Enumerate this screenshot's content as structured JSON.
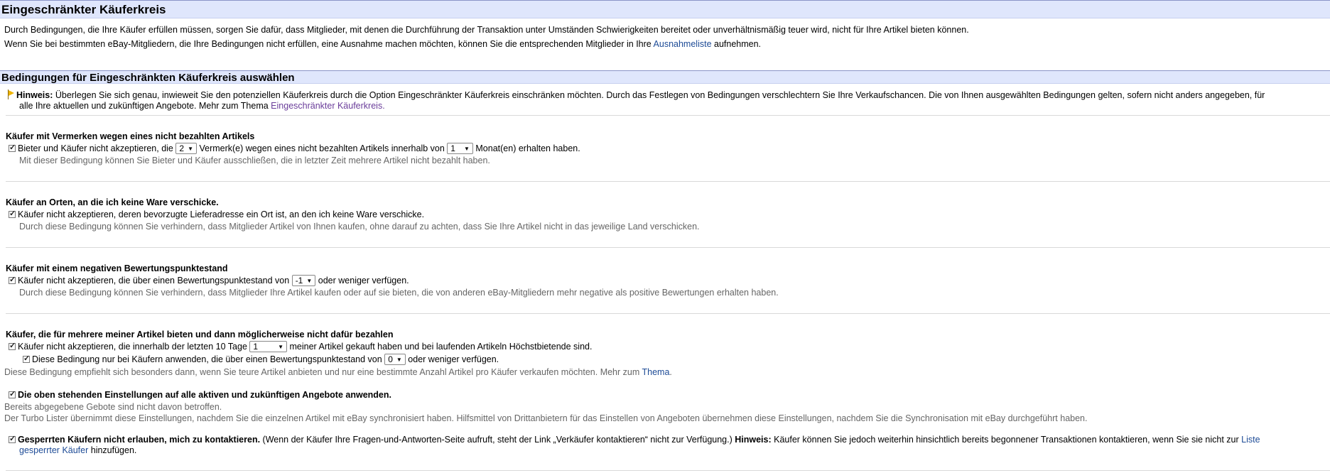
{
  "header": {
    "title": "Eingeschränkter Käuferkreis"
  },
  "intro": {
    "p1": "Durch Bedingungen, die Ihre Käufer erfüllen müssen, sorgen Sie dafür, dass Mitglieder, mit denen die Durchführung der Transaktion unter Umständen Schwierigkeiten bereitet oder unverhältnismäßig teuer wird, nicht für Ihre Artikel bieten können.",
    "p2_pre": "Wenn Sie bei bestimmten eBay-Mitgliedern, die Ihre Bedingungen nicht erfüllen, eine Ausnahme machen möchten, können Sie die entsprechenden Mitglieder in Ihre ",
    "p2_link": "Ausnahmeliste",
    "p2_post": " aufnehmen."
  },
  "conditions_header": {
    "title": "Bedingungen für Eingeschränkten Käuferkreis auswählen"
  },
  "hint": {
    "label": "Hinweis:",
    "line1": " Überlegen Sie sich genau, inwieweit Sie den potenziellen Käuferkreis durch die Option Eingeschränkter Käuferkreis einschränken möchten. Durch das Festlegen von Bedingungen verschlechtern Sie Ihre Verkaufschancen. Die von Ihnen ausgewählten Bedingungen gelten, sofern nicht anders angegeben, für",
    "line2_pre": "alle Ihre aktuellen und zukünftigen Angebote. Mehr zum Thema ",
    "line2_link": "Eingeschränkter Käuferkreis."
  },
  "sec1": {
    "title": "Käufer mit Vermerken wegen eines nicht bezahlten Artikels",
    "t1": "Bieter und Käufer nicht akzeptieren, die",
    "sel1": "2",
    "t2": "Vermerk(e) wegen eines nicht bezahlten Artikels innerhalb von",
    "sel2": "1",
    "t3": "Monat(en) erhalten haben.",
    "desc": "Mit dieser Bedingung können Sie Bieter und Käufer ausschließen, die in letzter Zeit mehrere Artikel nicht bezahlt haben."
  },
  "sec2": {
    "title": "Käufer an Orten, an die ich keine Ware verschicke.",
    "t1": "Käufer nicht akzeptieren, deren bevorzugte Lieferadresse ein Ort ist, an den ich keine Ware verschicke.",
    "desc": "Durch diese Bedingung können Sie verhindern, dass Mitglieder Artikel von Ihnen kaufen, ohne darauf zu achten, dass Sie Ihre Artikel nicht in das jeweilige Land verschicken."
  },
  "sec3": {
    "title": "Käufer mit einem negativen Bewertungspunktestand",
    "t1": "Käufer nicht akzeptieren, die über einen Bewertungspunktestand von",
    "sel1": "-1",
    "t2": "oder weniger verfügen.",
    "desc": "Durch diese Bedingung können Sie verhindern, dass Mitglieder Ihre Artikel kaufen oder auf sie bieten, die von anderen eBay-Mitgliedern mehr negative als positive Bewertungen erhalten haben."
  },
  "sec4": {
    "title": "Käufer, die für mehrere meiner Artikel bieten und dann möglicherweise nicht dafür bezahlen",
    "t1": "Käufer nicht akzeptieren, die innerhalb der letzten 10 Tage",
    "sel1": "1",
    "t2": "meiner Artikel gekauft haben und bei laufenden Artikeln Höchstbietende sind.",
    "t3": "Diese Bedingung nur bei Käufern anwenden, die über einen Bewertungspunktestand von",
    "sel2": "0",
    "t4": "oder weniger verfügen.",
    "desc_pre": "Diese Bedingung empfiehlt sich besonders dann, wenn Sie teure Artikel anbieten und nur eine bestimmte Anzahl Artikel pro Käufer verkaufen möchten. Mehr zum ",
    "desc_link": "Thema",
    "desc_post": "."
  },
  "apply": {
    "label": "Die oben stehenden Einstellungen auf alle aktiven und zukünftigen Angebote anwenden.",
    "note1": "Bereits abgegebene Gebote sind nicht davon betroffen.",
    "note2": "Der Turbo Lister übernimmt diese Einstellungen, nachdem Sie die einzelnen Artikel mit eBay synchronisiert haben. Hilfsmittel von Drittanbietern für das Einstellen von Angeboten übernehmen diese Einstellungen, nachdem Sie die Synchronisation mit eBay durchgeführt haben."
  },
  "blocked": {
    "label": "Gesperrten Käufern nicht erlauben, mich zu kontaktieren.",
    "paren": " (Wenn der Käufer Ihre Fragen-und-Antworten-Seite aufruft, steht der Link „Verkäufer kontaktieren“ nicht zur Verfügung.) ",
    "hint_label": "Hinweis:",
    "hint_text": " Käufer können Sie jedoch weiterhin hinsichtlich bereits begonnener Transaktionen kontaktieren, wenn Sie sie nicht zur ",
    "link1": "Liste",
    "link2": "gesperrter Käufer",
    "post": " hinzufügen."
  }
}
